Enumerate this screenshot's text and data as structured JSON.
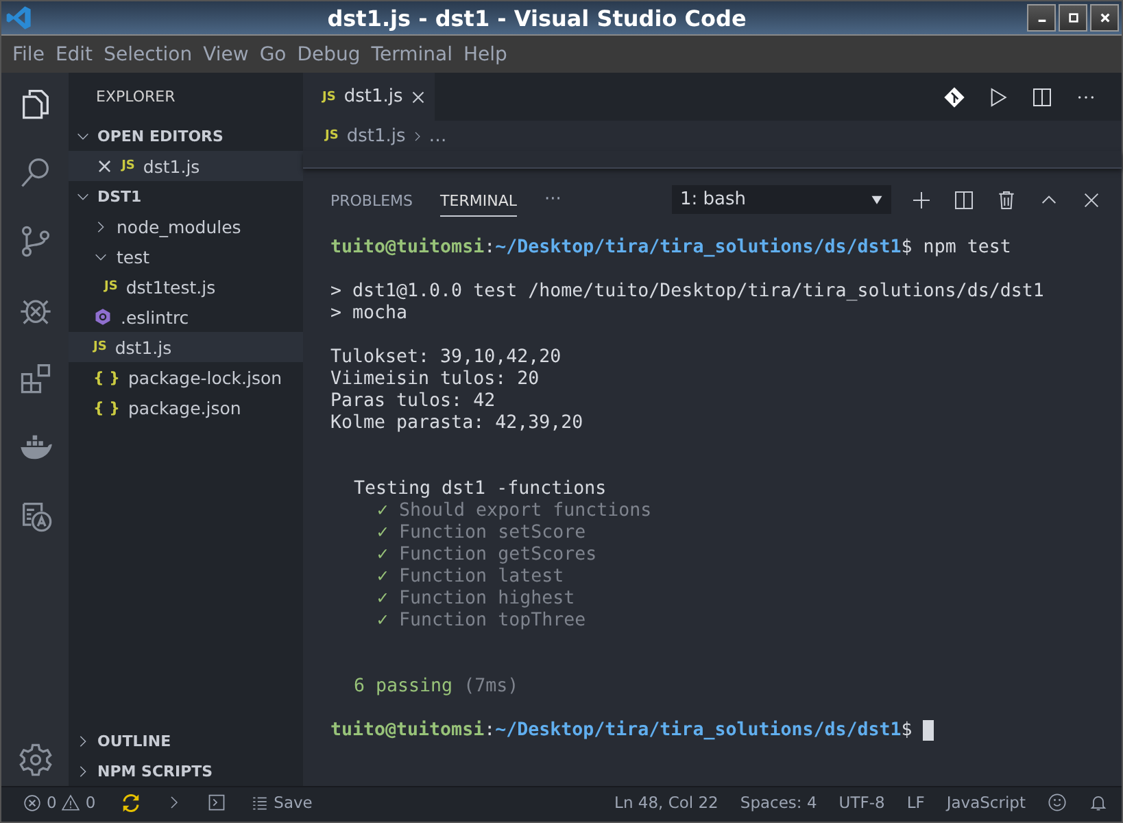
{
  "window": {
    "title": "dst1.js - dst1 - Visual Studio Code"
  },
  "menu": [
    "File",
    "Edit",
    "Selection",
    "View",
    "Go",
    "Debug",
    "Terminal",
    "Help"
  ],
  "activity_bar": [
    {
      "kind": "files",
      "selected": true
    },
    {
      "kind": "search",
      "selected": false
    },
    {
      "kind": "scm",
      "selected": false
    },
    {
      "kind": "debug",
      "selected": false
    },
    {
      "kind": "extensions",
      "selected": false
    },
    {
      "kind": "docker",
      "selected": false
    },
    {
      "kind": "translate",
      "selected": false
    }
  ],
  "sidebar": {
    "title": "EXPLORER",
    "open_editors": {
      "label": "OPEN EDITORS",
      "expanded": true,
      "items": [
        {
          "name": "dst1.js",
          "kind": "js",
          "icon": "JS",
          "close": "×"
        }
      ]
    },
    "folder": {
      "label": "DST1",
      "expanded": true,
      "items": [
        {
          "name": "node_modules",
          "kind": "folder",
          "expanded": false,
          "selected": false
        },
        {
          "name": "test",
          "kind": "folder",
          "expanded": true,
          "selected": false,
          "children": [
            {
              "name": "dst1test.js",
              "kind": "js",
              "icon": "JS",
              "selected": false
            }
          ]
        },
        {
          "name": ".eslintrc",
          "kind": "eslint",
          "selected": false
        },
        {
          "name": "dst1.js",
          "kind": "js",
          "icon": "JS",
          "selected": true
        },
        {
          "name": "package-lock.json",
          "kind": "json",
          "icon": "{ }",
          "selected": false
        },
        {
          "name": "package.json",
          "kind": "json",
          "icon": "{ }",
          "selected": false
        }
      ]
    },
    "sections": [
      {
        "label": "OUTLINE",
        "expanded": false
      },
      {
        "label": "NPM SCRIPTS",
        "expanded": false
      }
    ]
  },
  "editor": {
    "tabs": [
      {
        "label": "dst1.js",
        "kind": "js",
        "icon": "JS",
        "selected": true
      }
    ],
    "breadcrumb": {
      "kind": "js",
      "icon": "JS",
      "file": "dst1.js",
      "rest": "…"
    }
  },
  "panel": {
    "tabs": [
      {
        "label": "PROBLEMS",
        "selected": false
      },
      {
        "label": "TERMINAL",
        "selected": true
      }
    ],
    "more": "···",
    "terminal_select": "1: bash",
    "lines": [
      {
        "kind": "prompt",
        "user": "tuito@tuitomsi",
        "sep": ":",
        "path": "~/Desktop/tira/tira_solutions/ds/dst1",
        "command": "$ npm test",
        "cursor": false
      },
      {
        "kind": "blank"
      },
      {
        "kind": "text",
        "text": "> dst1@1.0.0 test /home/tuito/Desktop/tira/tira_solutions/ds/dst1"
      },
      {
        "kind": "text",
        "text": "> mocha"
      },
      {
        "kind": "blank"
      },
      {
        "kind": "text",
        "text": "Tulokset: 39,10,42,20"
      },
      {
        "kind": "text",
        "text": "Viimeisin tulos: 20"
      },
      {
        "kind": "text",
        "text": "Paras tulos: 42"
      },
      {
        "kind": "text",
        "text": "Kolme parasta: 42,39,20"
      },
      {
        "kind": "blank"
      },
      {
        "kind": "blank"
      },
      {
        "kind": "suite",
        "text": "Testing dst1 -functions"
      },
      {
        "kind": "pass",
        "mark": "✓",
        "text": "Should export functions"
      },
      {
        "kind": "pass",
        "mark": "✓",
        "text": "Function setScore"
      },
      {
        "kind": "pass",
        "mark": "✓",
        "text": "Function getScores"
      },
      {
        "kind": "pass",
        "mark": "✓",
        "text": "Function latest"
      },
      {
        "kind": "pass",
        "mark": "✓",
        "text": "Function highest"
      },
      {
        "kind": "pass",
        "mark": "✓",
        "text": "Function topThree"
      },
      {
        "kind": "blank"
      },
      {
        "kind": "blank"
      },
      {
        "kind": "summary",
        "count": "6 passing",
        "time": "(7ms)"
      },
      {
        "kind": "blank"
      },
      {
        "kind": "prompt",
        "user": "tuito@tuitomsi",
        "sep": ":",
        "path": "~/Desktop/tira/tira_solutions/ds/dst1",
        "command": "$ ",
        "cursor": true
      }
    ]
  },
  "status_bar": {
    "errors": "0",
    "warnings": "0",
    "save": "Save",
    "right": [
      "Ln 48, Col 22",
      "Spaces: 4",
      "UTF-8",
      "LF",
      "JavaScript"
    ]
  }
}
